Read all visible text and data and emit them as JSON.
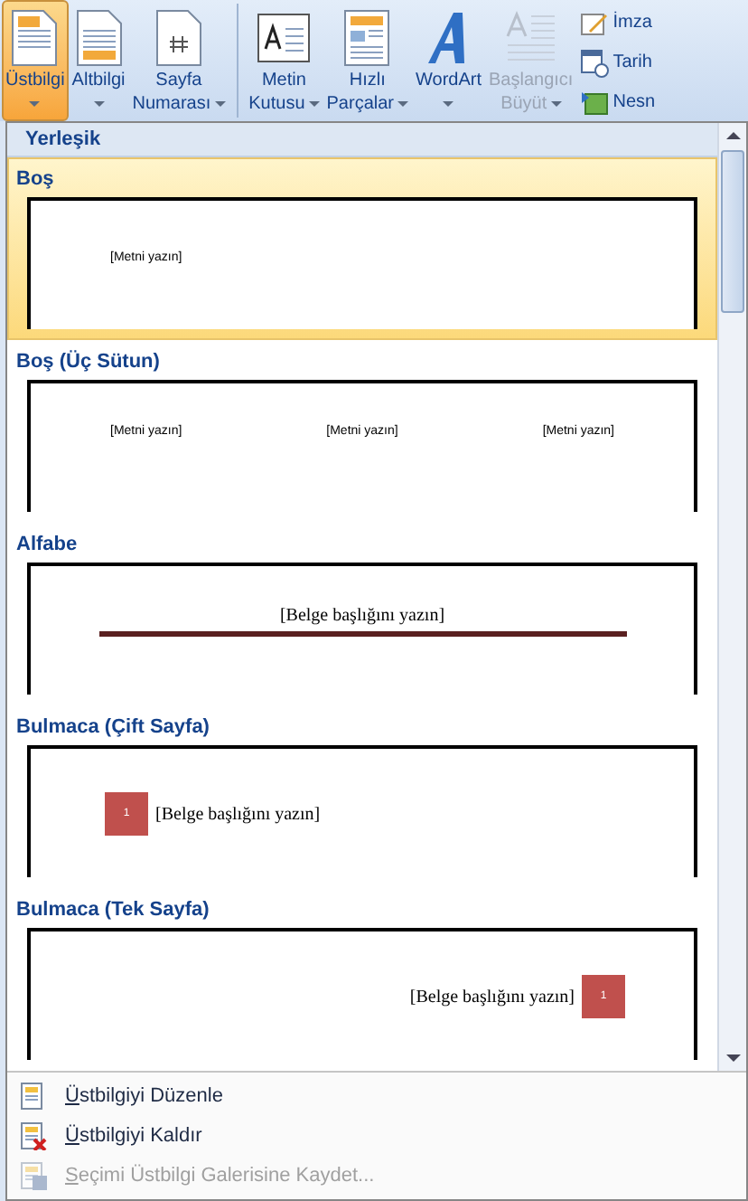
{
  "ribbon": {
    "large_buttons": [
      {
        "label": [
          "Üstbilgi"
        ],
        "selected": true,
        "disabled": false
      },
      {
        "label": [
          "Altbilgi"
        ],
        "selected": false,
        "disabled": false
      },
      {
        "label": [
          "Sayfa",
          "Numarası"
        ],
        "selected": false,
        "disabled": false
      },
      {
        "label": [
          "Metin",
          "Kutusu"
        ],
        "selected": false,
        "disabled": false
      },
      {
        "label": [
          "Hızlı",
          "Parçalar"
        ],
        "selected": false,
        "disabled": false
      },
      {
        "label": [
          "WordArt"
        ],
        "selected": false,
        "disabled": false
      },
      {
        "label": [
          "Başlangıcı",
          "Büyüt"
        ],
        "selected": false,
        "disabled": true
      }
    ],
    "small_buttons": [
      {
        "label": "İmza"
      },
      {
        "label": "Tarih"
      },
      {
        "label": "Nesn"
      }
    ]
  },
  "gallery": {
    "section": "Yerleşik",
    "items": [
      {
        "title": "Boş",
        "kind": "single",
        "texts": [
          "[Metni yazın]"
        ],
        "selected": true
      },
      {
        "title": "Boş (Üç Sütun)",
        "kind": "three",
        "texts": [
          "[Metni yazın]",
          "[Metni yazın]",
          "[Metni yazın]"
        ],
        "selected": false
      },
      {
        "title": "Alfabe",
        "kind": "line",
        "texts": [
          "[Belge başlığını yazın]"
        ],
        "selected": false
      },
      {
        "title": "Bulmaca (Çift Sayfa)",
        "kind": "box-left",
        "texts": [
          "1",
          "[Belge başlığını yazın]"
        ],
        "selected": false
      },
      {
        "title": "Bulmaca (Tek Sayfa)",
        "kind": "box-right",
        "texts": [
          "[Belge başlığını yazın]",
          "1"
        ],
        "selected": false
      }
    ]
  },
  "menu": [
    {
      "label": "Üstbilgiyi Düzenle",
      "disabled": false
    },
    {
      "label": "Üstbilgiyi Kaldır",
      "disabled": false
    },
    {
      "label": "Seçimi Üstbilgi Galerisine Kaydet...",
      "disabled": true
    }
  ]
}
